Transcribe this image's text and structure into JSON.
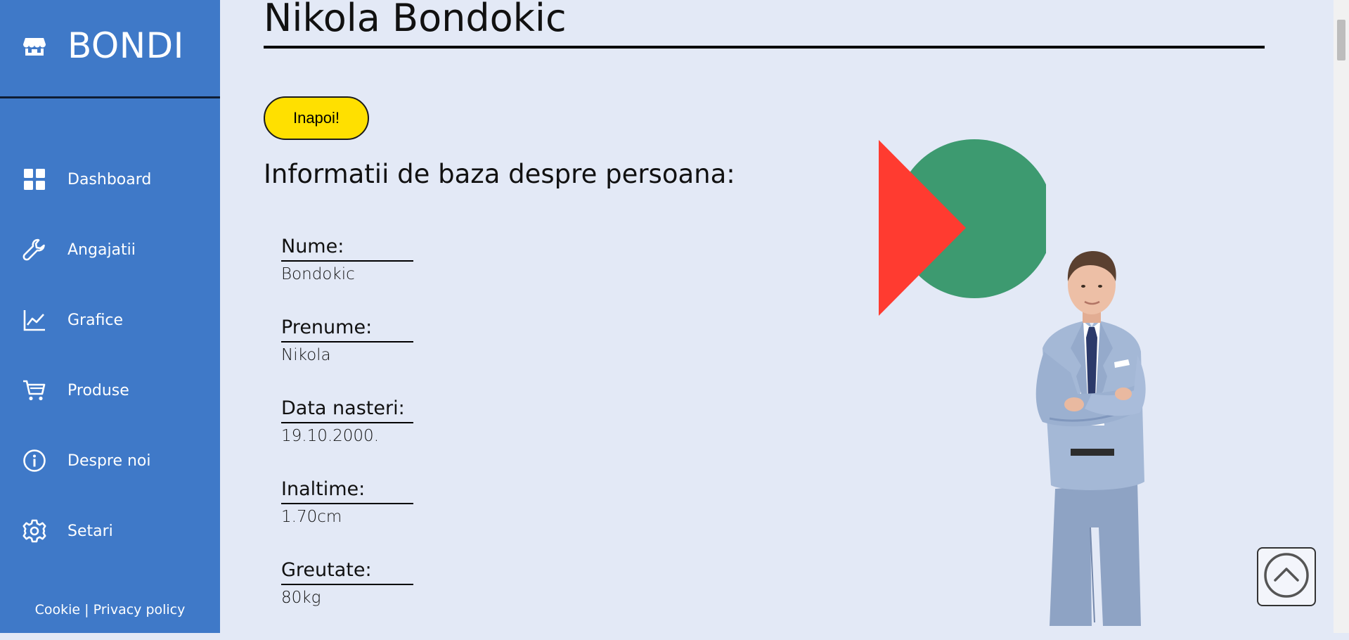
{
  "brand": {
    "name": "BONDI",
    "icon": "store-icon"
  },
  "nav": {
    "items": [
      {
        "label": "Dashboard",
        "icon": "dashboard-grid-icon"
      },
      {
        "label": "Angajatii",
        "icon": "wrench-icon"
      },
      {
        "label": "Grafice",
        "icon": "line-chart-icon"
      },
      {
        "label": "Produse",
        "icon": "cart-icon"
      },
      {
        "label": "Despre noi",
        "icon": "info-icon"
      },
      {
        "label": "Setari",
        "icon": "gear-icon"
      }
    ]
  },
  "footer": {
    "cookie": "Cookie",
    "separator": " | ",
    "privacy": "Privacy policy"
  },
  "page": {
    "title": "Nikola Bondokic",
    "back_label": "Inapoi!",
    "section_title": "Informatii de baza despre persoana:"
  },
  "person_info": [
    {
      "label": "Nume:",
      "value": "Bondokic"
    },
    {
      "label": "Prenume:",
      "value": "Nikola"
    },
    {
      "label": "Data nasteri:",
      "value": "19.10.2000."
    },
    {
      "label": "Inaltime:",
      "value": "1.70cm"
    },
    {
      "label": "Greutate:",
      "value": "80kg"
    }
  ],
  "colors": {
    "sidebar": "#3f79c8",
    "background": "#e3e9f6",
    "button": "#ffe000",
    "circle": "#3d9a70",
    "triangle": "#ff3b30"
  },
  "scroll_top_icon": "chevron-up-circle-icon"
}
